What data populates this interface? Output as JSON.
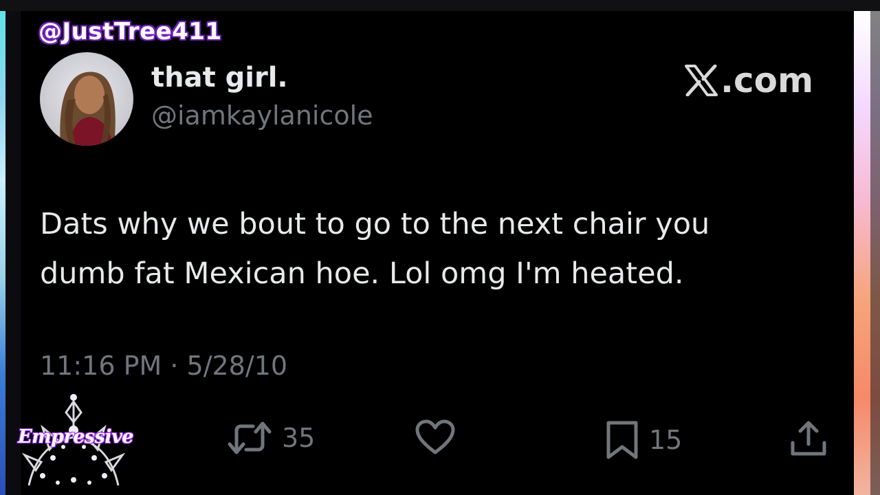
{
  "overlay": {
    "watermark_handle": "@JustTree411",
    "badge_label": "Empressive"
  },
  "tweet": {
    "display_name": "that girl.",
    "handle": "@iamkaylanicole",
    "brand_suffix": ".com",
    "text_lines": [
      "Dats why we bout to go to the next chair you",
      "dumb fat Mexican hoe. Lol omg I'm heated."
    ],
    "timestamp": "11:16 PM · 5/28/10",
    "actions": {
      "retweet_count": "35",
      "bookmark_count": "15"
    }
  },
  "icons": {
    "brand": "x-logo-icon",
    "retweet": "retweet-icon",
    "like": "heart-icon",
    "bookmark": "bookmark-icon",
    "share": "share-icon",
    "badge": "tiara-icon"
  },
  "colors": {
    "card_background": "#000000",
    "primary_text": "#e7e9ea",
    "secondary_text": "#71767b",
    "watermark_outline": "#6a1fb0"
  }
}
